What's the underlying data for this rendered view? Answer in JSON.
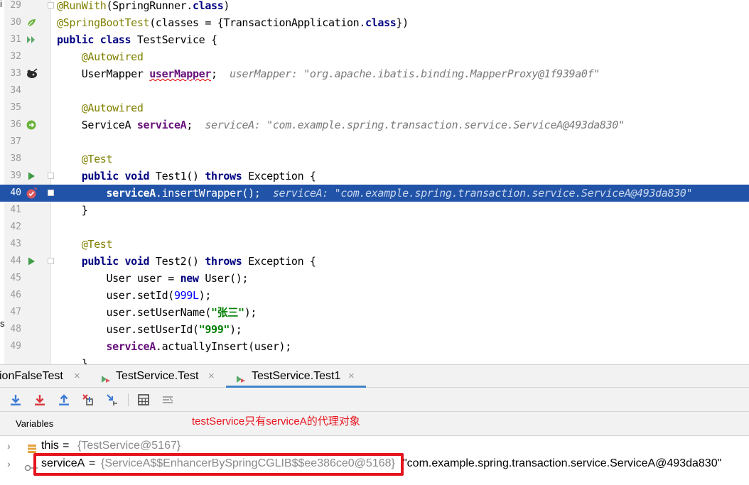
{
  "editor": {
    "left_fragments": [
      "i",
      "s"
    ],
    "lines": [
      {
        "num": "29",
        "tokens": [
          {
            "t": "@RunWith",
            "c": "ann"
          },
          {
            "t": "(SpringRunner."
          },
          {
            "t": "class",
            "c": "kw"
          },
          {
            "t": ")"
          }
        ]
      },
      {
        "num": "30",
        "tokens": [
          {
            "t": "@SpringBootTest",
            "c": "ann"
          },
          {
            "t": "(classes = {TransactionApplication."
          },
          {
            "t": "class",
            "c": "kw"
          },
          {
            "t": "})"
          }
        ]
      },
      {
        "num": "31",
        "tokens": [
          {
            "t": "public class ",
            "c": "kw"
          },
          {
            "t": "TestService {"
          }
        ]
      },
      {
        "num": "32",
        "tokens": [
          {
            "t": "    "
          },
          {
            "t": "@Autowired",
            "c": "ann"
          }
        ]
      },
      {
        "num": "33",
        "tokens": [
          {
            "t": "    UserMapper "
          },
          {
            "t": "userMapper",
            "c": "fld squig"
          },
          {
            "t": ";  "
          },
          {
            "t": "userMapper: \"org.apache.ibatis.binding.MapperProxy@1f939a0f\"",
            "c": "inl"
          }
        ]
      },
      {
        "num": "34",
        "tokens": []
      },
      {
        "num": "35",
        "tokens": [
          {
            "t": "    "
          },
          {
            "t": "@Autowired",
            "c": "ann"
          }
        ]
      },
      {
        "num": "36",
        "tokens": [
          {
            "t": "    ServiceA "
          },
          {
            "t": "serviceA",
            "c": "fld"
          },
          {
            "t": ";  "
          },
          {
            "t": "serviceA: \"com.example.spring.transaction.service.ServiceA@493da830\"",
            "c": "inl"
          }
        ]
      },
      {
        "num": "37",
        "tokens": []
      },
      {
        "num": "38",
        "tokens": [
          {
            "t": "    "
          },
          {
            "t": "@Test",
            "c": "ann"
          }
        ]
      },
      {
        "num": "39",
        "tokens": [
          {
            "t": "    "
          },
          {
            "t": "public void ",
            "c": "kw"
          },
          {
            "t": "Test1() "
          },
          {
            "t": "throws ",
            "c": "kw"
          },
          {
            "t": "Exception {"
          }
        ]
      },
      {
        "num": "40",
        "current": true,
        "tokens": [
          {
            "t": "        "
          },
          {
            "t": "serviceA",
            "c": "fld"
          },
          {
            "t": ".insertWrapper();  "
          },
          {
            "t": "serviceA: \"com.example.spring.transaction.service.ServiceA@493da830\"",
            "c": "inl"
          }
        ]
      },
      {
        "num": "41",
        "tokens": [
          {
            "t": "    }"
          }
        ]
      },
      {
        "num": "42",
        "tokens": []
      },
      {
        "num": "43",
        "tokens": [
          {
            "t": "    "
          },
          {
            "t": "@Test",
            "c": "ann"
          }
        ]
      },
      {
        "num": "44",
        "tokens": [
          {
            "t": "    "
          },
          {
            "t": "public void ",
            "c": "kw"
          },
          {
            "t": "Test2() "
          },
          {
            "t": "throws ",
            "c": "kw"
          },
          {
            "t": "Exception {"
          }
        ]
      },
      {
        "num": "45",
        "tokens": [
          {
            "t": "        User user = "
          },
          {
            "t": "new ",
            "c": "kw"
          },
          {
            "t": "User();"
          }
        ]
      },
      {
        "num": "46",
        "tokens": [
          {
            "t": "        user.setId("
          },
          {
            "t": "999L",
            "c": "num"
          },
          {
            "t": ");"
          }
        ]
      },
      {
        "num": "47",
        "tokens": [
          {
            "t": "        user.setUserName("
          },
          {
            "t": "\"张三\"",
            "c": "str"
          },
          {
            "t": ");"
          }
        ]
      },
      {
        "num": "48",
        "tokens": [
          {
            "t": "        user.setUserId("
          },
          {
            "t": "\"999\"",
            "c": "str"
          },
          {
            "t": ");"
          }
        ]
      },
      {
        "num": "49",
        "tokens": [
          {
            "t": "        "
          },
          {
            "t": "serviceA",
            "c": "fld"
          },
          {
            "t": ".actuallyInsert(user);"
          }
        ]
      },
      {
        "num": "",
        "tokens": [
          {
            "t": "    }"
          }
        ]
      }
    ]
  },
  "debug": {
    "tabs": [
      {
        "label": "ionFalseTest",
        "close": "×",
        "icon": null,
        "active": false
      },
      {
        "label": "TestService.Test",
        "close": "×",
        "icon": "run-config-icon",
        "active": false
      },
      {
        "label": "TestService.Test1",
        "close": "×",
        "icon": "run-config-icon",
        "active": true
      }
    ],
    "toolbar": {
      "buttons": [
        "step-over-icon",
        "step-into-icon",
        "step-out-icon",
        "force-step-into-icon",
        "run-to-cursor-icon",
        "evaluate-expression-icon",
        "trace-current-stream-icon"
      ]
    },
    "annotation": "testService只有serviceA的代理对象",
    "variables": {
      "title": "Variables",
      "rows": [
        {
          "name": "this",
          "eq": " = ",
          "value": "{TestService@5167}",
          "desc": "",
          "icon": "field-icon",
          "expand": "›"
        },
        {
          "name": "serviceA",
          "eq": " = ",
          "value": "{ServiceA$$EnhancerBySpringCGLIB$$ee386ce0@5168}",
          "desc": "\"com.example.spring.transaction.service.ServiceA@493da830\"",
          "icon": "watch-icon",
          "expand": "›"
        }
      ]
    }
  },
  "colors": {
    "current_line": "#2154a8",
    "annotation_red": "#e8141d",
    "active_tab_underline": "#4083c9"
  }
}
